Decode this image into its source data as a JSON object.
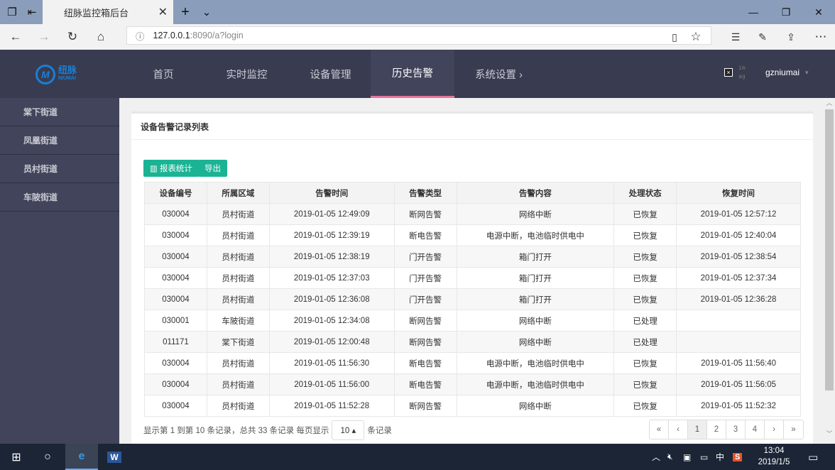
{
  "browser": {
    "tab_title": "纽脉监控箱后台",
    "url_host": "127.0.0.1",
    "url_path": ":8090/a?login"
  },
  "header": {
    "logo_text": "纽脉",
    "logo_sub": "NIUMAI",
    "nav": [
      {
        "label": "首页"
      },
      {
        "label": "实时监控"
      },
      {
        "label": "设备管理"
      },
      {
        "label": "历史告警"
      },
      {
        "label": "系统设置 ›"
      }
    ],
    "img_alt": "im ag",
    "username": "gzniumai"
  },
  "sidebar": {
    "items": [
      {
        "label": "棠下街道"
      },
      {
        "label": "凤凰街道"
      },
      {
        "label": "员村街道"
      },
      {
        "label": "车陂街道"
      }
    ]
  },
  "panel": {
    "title": "设备告警记录列表",
    "report_button": "报表统计",
    "export_button": "导出"
  },
  "table": {
    "columns": [
      "设备编号",
      "所属区域",
      "告警时间",
      "告警类型",
      "告警内容",
      "处理状态",
      "恢复时间"
    ],
    "rows": [
      [
        "030004",
        "员村街道",
        "2019-01-05 12:49:09",
        "断网告警",
        "网络中断",
        "已恢复",
        "2019-01-05 12:57:12"
      ],
      [
        "030004",
        "员村街道",
        "2019-01-05 12:39:19",
        "断电告警",
        "电源中断，电池临时供电中",
        "已恢复",
        "2019-01-05 12:40:04"
      ],
      [
        "030004",
        "员村街道",
        "2019-01-05 12:38:19",
        "门开告警",
        "箱门打开",
        "已恢复",
        "2019-01-05 12:38:54"
      ],
      [
        "030004",
        "员村街道",
        "2019-01-05 12:37:03",
        "门开告警",
        "箱门打开",
        "已恢复",
        "2019-01-05 12:37:34"
      ],
      [
        "030004",
        "员村街道",
        "2019-01-05 12:36:08",
        "门开告警",
        "箱门打开",
        "已恢复",
        "2019-01-05 12:36:28"
      ],
      [
        "030001",
        "车陂街道",
        "2019-01-05 12:34:08",
        "断网告警",
        "网络中断",
        "已处理",
        ""
      ],
      [
        "011171",
        "棠下街道",
        "2019-01-05 12:00:48",
        "断网告警",
        "网络中断",
        "已处理",
        ""
      ],
      [
        "030004",
        "员村街道",
        "2019-01-05 11:56:30",
        "断电告警",
        "电源中断，电池临时供电中",
        "已恢复",
        "2019-01-05 11:56:40"
      ],
      [
        "030004",
        "员村街道",
        "2019-01-05 11:56:00",
        "断电告警",
        "电源中断，电池临时供电中",
        "已恢复",
        "2019-01-05 11:56:05"
      ],
      [
        "030004",
        "员村街道",
        "2019-01-05 11:52:28",
        "断网告警",
        "网络中断",
        "已恢复",
        "2019-01-05 11:52:32"
      ]
    ]
  },
  "footer": {
    "summary": "显示第 1 到第 10 条记录，总共 33 条记录 每页显示",
    "page_size": "10 ▴",
    "suffix": "条记录"
  },
  "pager": [
    "«",
    "‹",
    "1",
    "2",
    "3",
    "4",
    "›",
    "»"
  ],
  "taskbar": {
    "time": "13:04",
    "date": "2019/1/5",
    "ime": "中"
  }
}
